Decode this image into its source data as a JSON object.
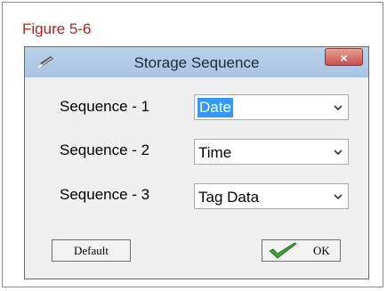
{
  "figure_label": "Figure 5-6",
  "window": {
    "title": "Storage Sequence",
    "close_label": "×"
  },
  "sequences": [
    {
      "label": "Sequence - 1",
      "value": "Date"
    },
    {
      "label": "Sequence - 2",
      "value": "Time"
    },
    {
      "label": "Sequence - 3",
      "value": "Tag Data"
    }
  ],
  "buttons": {
    "default_label": "Default",
    "ok_label": "OK"
  },
  "colors": {
    "figure_label": "#b22222",
    "close_button": "#c75050",
    "selection": "#3399ff",
    "checkmark": "#3aa335"
  },
  "icons": {
    "app": "pencil-icon",
    "close": "close-icon",
    "dropdown": "chevron-down-icon",
    "ok": "checkmark-icon"
  }
}
